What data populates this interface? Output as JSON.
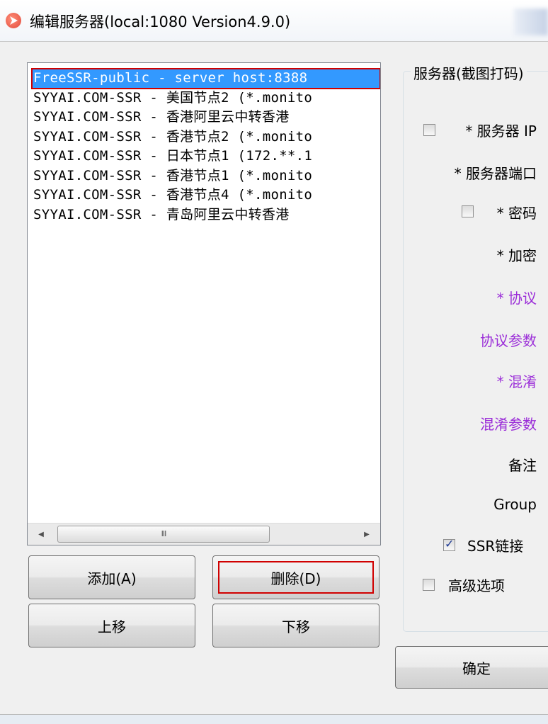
{
  "window": {
    "title": "编辑服务器(local:1080 Version4.9.0)"
  },
  "server_list": {
    "items": [
      {
        "label": "FreeSSR-public - server host:8388",
        "selected": true
      },
      {
        "label": "SYYAI.COM-SSR - 美国节点2 (*.monito",
        "selected": false
      },
      {
        "label": "SYYAI.COM-SSR - 香港阿里云中转香港",
        "selected": false
      },
      {
        "label": "SYYAI.COM-SSR - 香港节点2 (*.monito",
        "selected": false
      },
      {
        "label": "SYYAI.COM-SSR - 日本节点1 (172.**.1",
        "selected": false
      },
      {
        "label": "SYYAI.COM-SSR - 香港节点1 (*.monito",
        "selected": false
      },
      {
        "label": "SYYAI.COM-SSR - 香港节点4 (*.monito",
        "selected": false
      },
      {
        "label": "SYYAI.COM-SSR - 青岛阿里云中转香港",
        "selected": false
      }
    ],
    "scroll_grip": "III"
  },
  "buttons": {
    "add": "添加(A)",
    "delete": "删除(D)",
    "move_up": "上移",
    "move_down": "下移",
    "ok": "确定"
  },
  "server_group": {
    "title": "服务器(截图打码)",
    "server_ip": "* 服务器 IP",
    "server_port": "* 服务器端口",
    "password": "* 密码",
    "encryption": "* 加密",
    "protocol": "* 协议",
    "protocol_param": "协议参数",
    "obfs": "* 混淆",
    "obfs_param": "混淆参数",
    "remarks": "备注",
    "group": "Group",
    "ssr_link": "SSR链接",
    "advanced": "高级选项"
  },
  "checkboxes": {
    "server_ip_checked": false,
    "password_checked": false,
    "ssr_link_checked": true,
    "advanced_checked": false
  },
  "colors": {
    "selection": "#3399ff",
    "purple_label": "#9b2ed8",
    "highlight_red": "#d00000"
  },
  "icons": {
    "app": "paper-plane-icon",
    "scroll_left": "arrow-left-icon",
    "scroll_right": "arrow-right-icon"
  }
}
